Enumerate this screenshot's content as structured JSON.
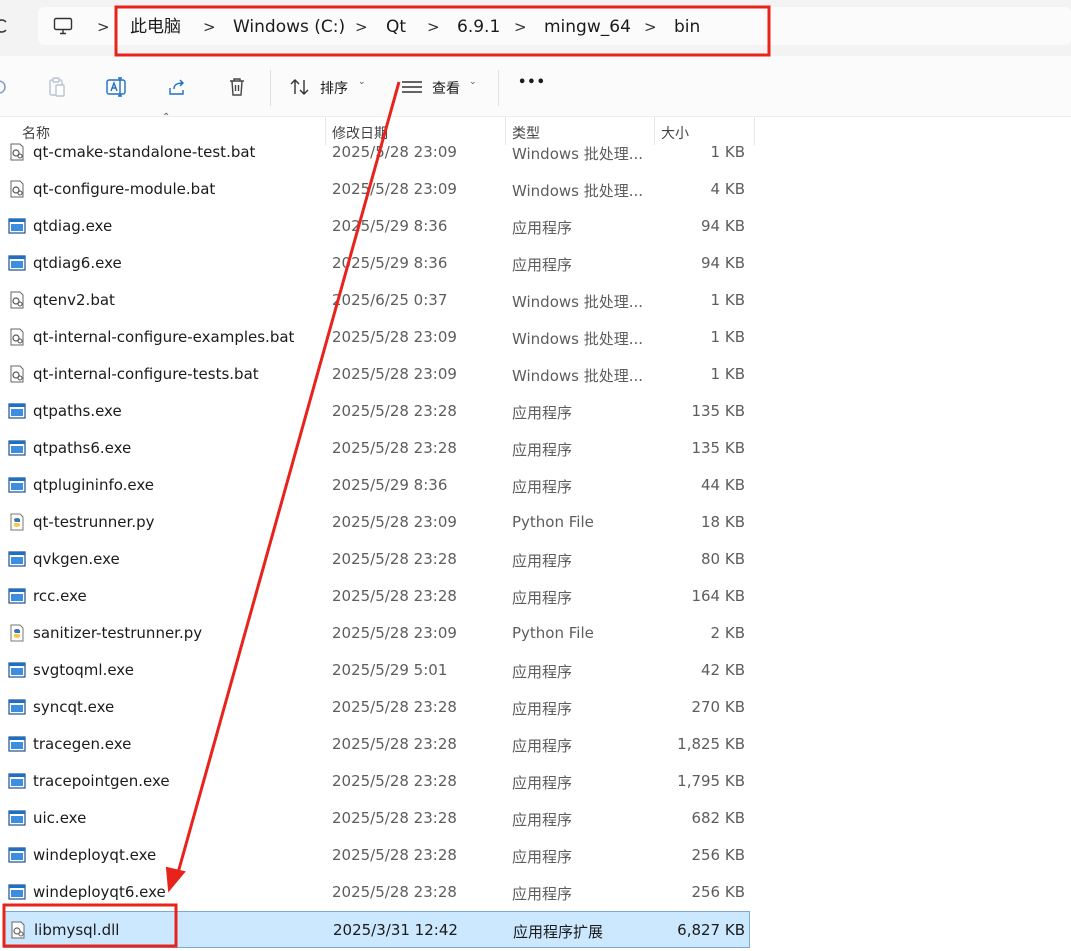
{
  "breadcrumb": {
    "items": [
      "此电脑",
      "Windows (C:)",
      "Qt",
      "6.9.1",
      "mingw_64",
      "bin"
    ],
    "separator": ">"
  },
  "toolbar": {
    "sort_label": "排序",
    "view_label": "查看",
    "more_label": "•••"
  },
  "columns": {
    "name": "名称",
    "date": "修改日期",
    "type": "类型",
    "size": "大小"
  },
  "files": [
    {
      "name": "qt-cmake-standalone-test.bat",
      "date": "2025/5/28 23:09",
      "type": "Windows 批处理...",
      "size": "1 KB",
      "icon": "batch-file-icon"
    },
    {
      "name": "qt-configure-module.bat",
      "date": "2025/5/28 23:09",
      "type": "Windows 批处理...",
      "size": "4 KB",
      "icon": "batch-file-icon"
    },
    {
      "name": "qtdiag.exe",
      "date": "2025/5/29 8:36",
      "type": "应用程序",
      "size": "94 KB",
      "icon": "exe-file-icon"
    },
    {
      "name": "qtdiag6.exe",
      "date": "2025/5/29 8:36",
      "type": "应用程序",
      "size": "94 KB",
      "icon": "exe-file-icon"
    },
    {
      "name": "qtenv2.bat",
      "date": "2025/6/25 0:37",
      "type": "Windows 批处理...",
      "size": "1 KB",
      "icon": "batch-file-icon"
    },
    {
      "name": "qt-internal-configure-examples.bat",
      "date": "2025/5/28 23:09",
      "type": "Windows 批处理...",
      "size": "1 KB",
      "icon": "batch-file-icon"
    },
    {
      "name": "qt-internal-configure-tests.bat",
      "date": "2025/5/28 23:09",
      "type": "Windows 批处理...",
      "size": "1 KB",
      "icon": "batch-file-icon"
    },
    {
      "name": "qtpaths.exe",
      "date": "2025/5/28 23:28",
      "type": "应用程序",
      "size": "135 KB",
      "icon": "exe-file-icon"
    },
    {
      "name": "qtpaths6.exe",
      "date": "2025/5/28 23:28",
      "type": "应用程序",
      "size": "135 KB",
      "icon": "exe-file-icon"
    },
    {
      "name": "qtplugininfo.exe",
      "date": "2025/5/29 8:36",
      "type": "应用程序",
      "size": "44 KB",
      "icon": "exe-file-icon"
    },
    {
      "name": "qt-testrunner.py",
      "date": "2025/5/28 23:09",
      "type": "Python File",
      "size": "18 KB",
      "icon": "python-file-icon"
    },
    {
      "name": "qvkgen.exe",
      "date": "2025/5/28 23:28",
      "type": "应用程序",
      "size": "80 KB",
      "icon": "exe-file-icon"
    },
    {
      "name": "rcc.exe",
      "date": "2025/5/28 23:28",
      "type": "应用程序",
      "size": "164 KB",
      "icon": "exe-file-icon"
    },
    {
      "name": "sanitizer-testrunner.py",
      "date": "2025/5/28 23:09",
      "type": "Python File",
      "size": "2 KB",
      "icon": "python-file-icon"
    },
    {
      "name": "svgtoqml.exe",
      "date": "2025/5/29 5:01",
      "type": "应用程序",
      "size": "42 KB",
      "icon": "exe-file-icon"
    },
    {
      "name": "syncqt.exe",
      "date": "2025/5/28 23:28",
      "type": "应用程序",
      "size": "270 KB",
      "icon": "exe-file-icon"
    },
    {
      "name": "tracegen.exe",
      "date": "2025/5/28 23:28",
      "type": "应用程序",
      "size": "1,825 KB",
      "icon": "exe-file-icon"
    },
    {
      "name": "tracepointgen.exe",
      "date": "2025/5/28 23:28",
      "type": "应用程序",
      "size": "1,795 KB",
      "icon": "exe-file-icon"
    },
    {
      "name": "uic.exe",
      "date": "2025/5/28 23:28",
      "type": "应用程序",
      "size": "682 KB",
      "icon": "exe-file-icon"
    },
    {
      "name": "windeployqt.exe",
      "date": "2025/5/28 23:28",
      "type": "应用程序",
      "size": "256 KB",
      "icon": "exe-file-icon"
    },
    {
      "name": "windeployqt6.exe",
      "date": "2025/5/28 23:28",
      "type": "应用程序",
      "size": "256 KB",
      "icon": "exe-file-icon"
    },
    {
      "name": "libmysql.dll",
      "date": "2025/3/31 12:42",
      "type": "应用程序扩展",
      "size": "6,827 KB",
      "icon": "dll-file-icon",
      "selected": true
    }
  ],
  "colors": {
    "selection_bg": "#cce8ff",
    "selection_border": "#7aa9d4",
    "annotation_red": "#e8231b",
    "exe_icon_blue": "#1f6fc5"
  }
}
